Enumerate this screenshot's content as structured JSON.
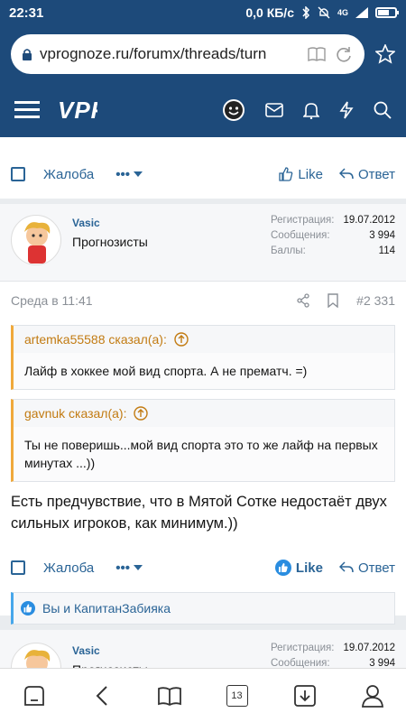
{
  "status": {
    "time": "22:31",
    "speed": "0,0 КБ/с",
    "network": "4G"
  },
  "browser": {
    "url": "vprognoze.ru/forumx/threads/turn",
    "tabs_count": "13"
  },
  "forum": {
    "logo": "VPROGNOZE"
  },
  "prev_post_actions": {
    "report": "Жалоба",
    "like": "Like",
    "reply": "Ответ"
  },
  "post": {
    "username": "Vasic",
    "role": "Прогнозисты",
    "stats": [
      {
        "label": "Регистрация:",
        "value": "19.07.2012"
      },
      {
        "label": "Сообщения:",
        "value": "3 994"
      },
      {
        "label": "Баллы:",
        "value": "114"
      }
    ],
    "time": "Среда в 11:41",
    "number": "#2 331",
    "quotes": [
      {
        "author": "artemka55588 сказал(а):",
        "text": "Лайф в хоккее мой вид спорта. А не прематч. =)"
      },
      {
        "author": "gavnuk сказал(а):",
        "text": "Ты не поверишь...мой вид спорта это то же лайф на первых минутах ...))"
      }
    ],
    "text": "Есть предчувствие, что в Мятой Сотке недостаёт двух сильных игроков, как минимум.))",
    "actions": {
      "report": "Жалоба",
      "like": "Like",
      "reply": "Ответ"
    },
    "likes_text": "Вы и КапитанЗабияка"
  },
  "next_post": {
    "username": "Vasic",
    "role": "Прогнозисты",
    "stats": [
      {
        "label": "Регистрация:",
        "value": "19.07.2012"
      },
      {
        "label": "Сообщения:",
        "value": "3 994"
      }
    ]
  },
  "colors": {
    "header": "#1d4a7a",
    "link": "#2a6496",
    "quote_accent": "#f0a93b",
    "likes_accent": "#47a7eb"
  }
}
